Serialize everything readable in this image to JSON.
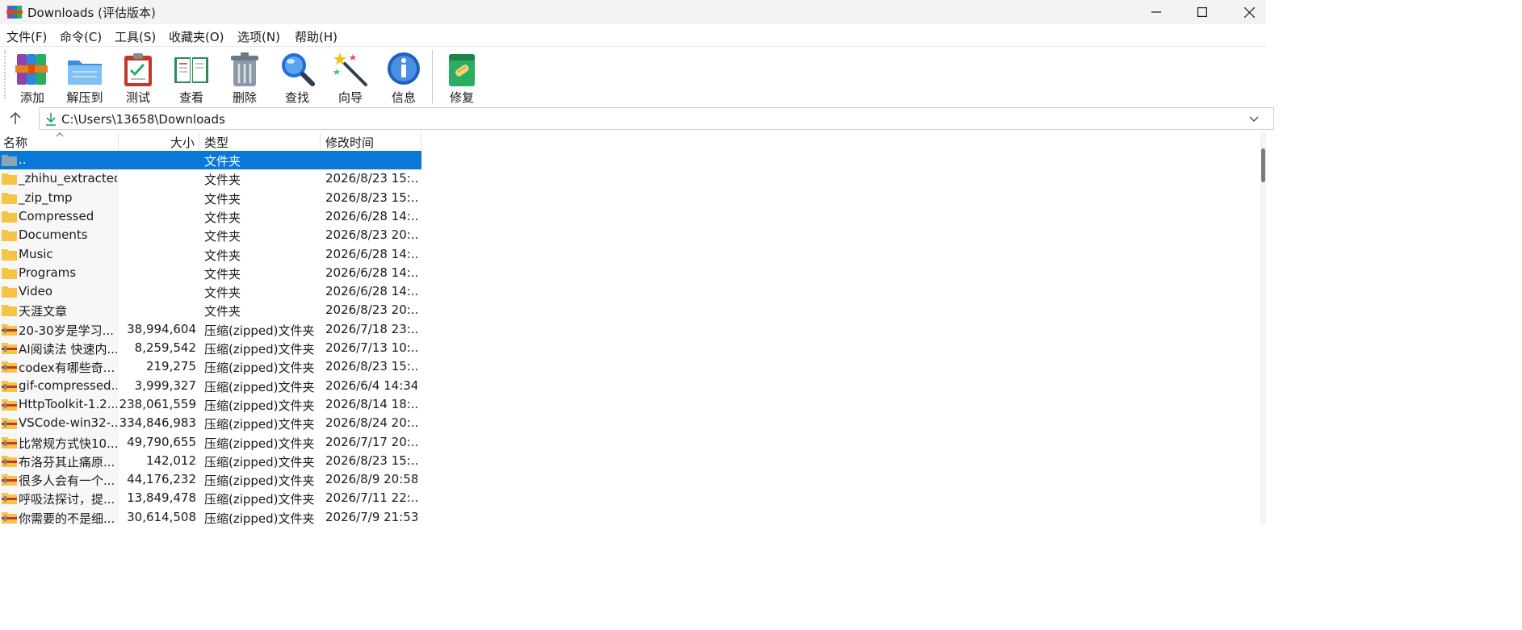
{
  "window": {
    "title": "Downloads (评估版本)"
  },
  "menu": [
    {
      "label": "文件(F)"
    },
    {
      "label": "命令(C)"
    },
    {
      "label": "工具(S)"
    },
    {
      "label": "收藏夹(O)"
    },
    {
      "label": "选项(N)"
    },
    {
      "label": "帮助(H)"
    }
  ],
  "toolbar": {
    "add": "添加",
    "extract": "解压到",
    "test": "测试",
    "view": "查看",
    "delete": "删除",
    "find": "查找",
    "wizard": "向导",
    "info": "信息",
    "repair": "修复"
  },
  "address": {
    "path": "C:\\Users\\13658\\Downloads"
  },
  "columns": {
    "name": "名称",
    "size": "大小",
    "type": "类型",
    "modified": "修改时间"
  },
  "files": [
    {
      "name": "..",
      "size": "",
      "type": "文件夹",
      "modified": "",
      "icon": "parent-folder-icon"
    },
    {
      "name": "_zhihu_extracted",
      "size": "",
      "type": "文件夹",
      "modified": "2026/8/23 15:...",
      "icon": "folder-icon"
    },
    {
      "name": "_zip_tmp",
      "size": "",
      "type": "文件夹",
      "modified": "2026/8/23 15:...",
      "icon": "folder-icon"
    },
    {
      "name": "Compressed",
      "size": "",
      "type": "文件夹",
      "modified": "2026/6/28 14:...",
      "icon": "folder-icon"
    },
    {
      "name": "Documents",
      "size": "",
      "type": "文件夹",
      "modified": "2026/8/23 20:...",
      "icon": "folder-icon"
    },
    {
      "name": "Music",
      "size": "",
      "type": "文件夹",
      "modified": "2026/6/28 14:...",
      "icon": "folder-icon"
    },
    {
      "name": "Programs",
      "size": "",
      "type": "文件夹",
      "modified": "2026/6/28 14:...",
      "icon": "folder-icon"
    },
    {
      "name": "Video",
      "size": "",
      "type": "文件夹",
      "modified": "2026/6/28 14:...",
      "icon": "folder-icon"
    },
    {
      "name": "天涯文章",
      "size": "",
      "type": "文件夹",
      "modified": "2026/8/23 20:...",
      "icon": "folder-icon"
    },
    {
      "name": "20-30岁是学习...",
      "size": "38,994,604",
      "type": "压缩(zipped)文件夹",
      "modified": "2026/7/18 23:...",
      "icon": "zip-folder-icon"
    },
    {
      "name": "AI阅读法 快速内...",
      "size": "8,259,542",
      "type": "压缩(zipped)文件夹",
      "modified": "2026/7/13 10:...",
      "icon": "zip-folder-icon"
    },
    {
      "name": "codex有哪些奇...",
      "size": "219,275",
      "type": "压缩(zipped)文件夹",
      "modified": "2026/8/23 15:...",
      "icon": "zip-folder-icon"
    },
    {
      "name": "gif-compressed...",
      "size": "3,999,327",
      "type": "压缩(zipped)文件夹",
      "modified": "2026/6/4 14:34",
      "icon": "zip-folder-icon"
    },
    {
      "name": "HttpToolkit-1.2...",
      "size": "238,061,559",
      "type": "压缩(zipped)文件夹",
      "modified": "2026/8/14 18:...",
      "icon": "zip-folder-icon"
    },
    {
      "name": "VSCode-win32-...",
      "size": "334,846,983",
      "type": "压缩(zipped)文件夹",
      "modified": "2026/8/24 20:...",
      "icon": "zip-folder-icon"
    },
    {
      "name": "比常规方式快10...",
      "size": "49,790,655",
      "type": "压缩(zipped)文件夹",
      "modified": "2026/7/17 20:...",
      "icon": "zip-folder-icon"
    },
    {
      "name": "布洛芬其止痛原...",
      "size": "142,012",
      "type": "压缩(zipped)文件夹",
      "modified": "2026/8/23 15:...",
      "icon": "zip-folder-icon"
    },
    {
      "name": "很多人会有一个...",
      "size": "44,176,232",
      "type": "压缩(zipped)文件夹",
      "modified": "2026/8/9 20:58",
      "icon": "zip-folder-icon"
    },
    {
      "name": "呼吸法探讨，提...",
      "size": "13,849,478",
      "type": "压缩(zipped)文件夹",
      "modified": "2026/7/11 22:...",
      "icon": "zip-folder-icon"
    },
    {
      "name": "你需要的不是细...",
      "size": "30,614,508",
      "type": "压缩(zipped)文件夹",
      "modified": "2026/7/9 21:53",
      "icon": "zip-folder-icon"
    }
  ],
  "colors": {
    "selection": "#0a78d7",
    "folder": "#f5c447",
    "zip_band": "#c0392b"
  }
}
